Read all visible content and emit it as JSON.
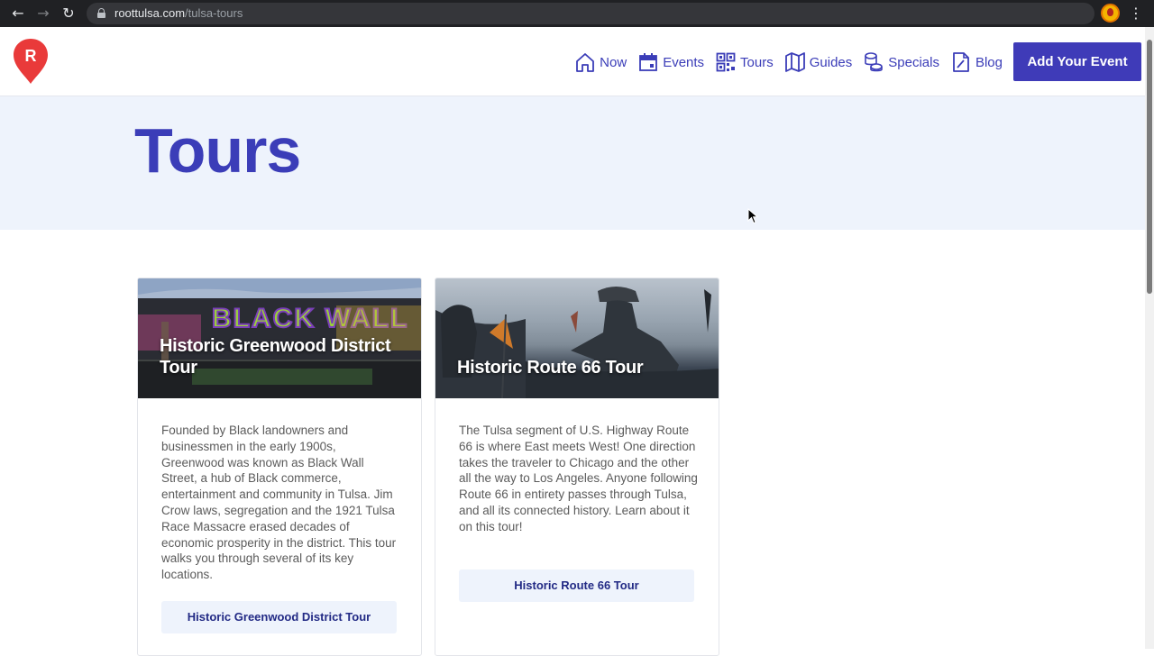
{
  "browser": {
    "url_host": "roottulsa.com",
    "url_path": "/tulsa-tours",
    "back_icon": "arrow-left-icon",
    "forward_icon": "arrow-right-icon",
    "reload_icon": "reload-icon",
    "bookmark_icon": "star-icon",
    "menu_icon": "kebab-menu-icon"
  },
  "header": {
    "logo_letter": "R",
    "logo_color": "#e93a3a",
    "nav": [
      {
        "label": "Now",
        "icon": "house-icon"
      },
      {
        "label": "Events",
        "icon": "calendar-icon"
      },
      {
        "label": "Tours",
        "icon": "qr-code-icon"
      },
      {
        "label": "Guides",
        "icon": "map-icon"
      },
      {
        "label": "Specials",
        "icon": "coins-icon"
      },
      {
        "label": "Blog",
        "icon": "document-pen-icon"
      }
    ],
    "cta_label": "Add Your Event",
    "accent": "#3f3bb8"
  },
  "hero": {
    "title": "Tours",
    "background": "#eef3fc"
  },
  "cards": [
    {
      "title": "Historic Greenwood District Tour",
      "image": "black-wall-street-mural-photo",
      "mural_text": "BLACK WALL",
      "description": "Founded by Black landowners and businessmen in the early 1900s, Greenwood was known as Black Wall Street, a hub of Black commerce, entertainment and community in Tulsa. Jim Crow laws, segregation and the 1921 Tulsa Race Massacre erased decades of economic prosperity in the district. This tour walks you through several of its key locations.",
      "button_label": "Historic Greenwood District Tour"
    },
    {
      "title": "Historic Route 66 Tour",
      "image": "route-66-statue-photo",
      "description": "The Tulsa segment of U.S. Highway Route 66 is where East meets West!  One direction takes the traveler to Chicago and the other all the way to Los Angeles. Anyone following Route 66 in entirety passes through Tulsa, and all its connected history. Learn about it on this tour!",
      "button_label": "Historic Route 66 Tour"
    }
  ]
}
